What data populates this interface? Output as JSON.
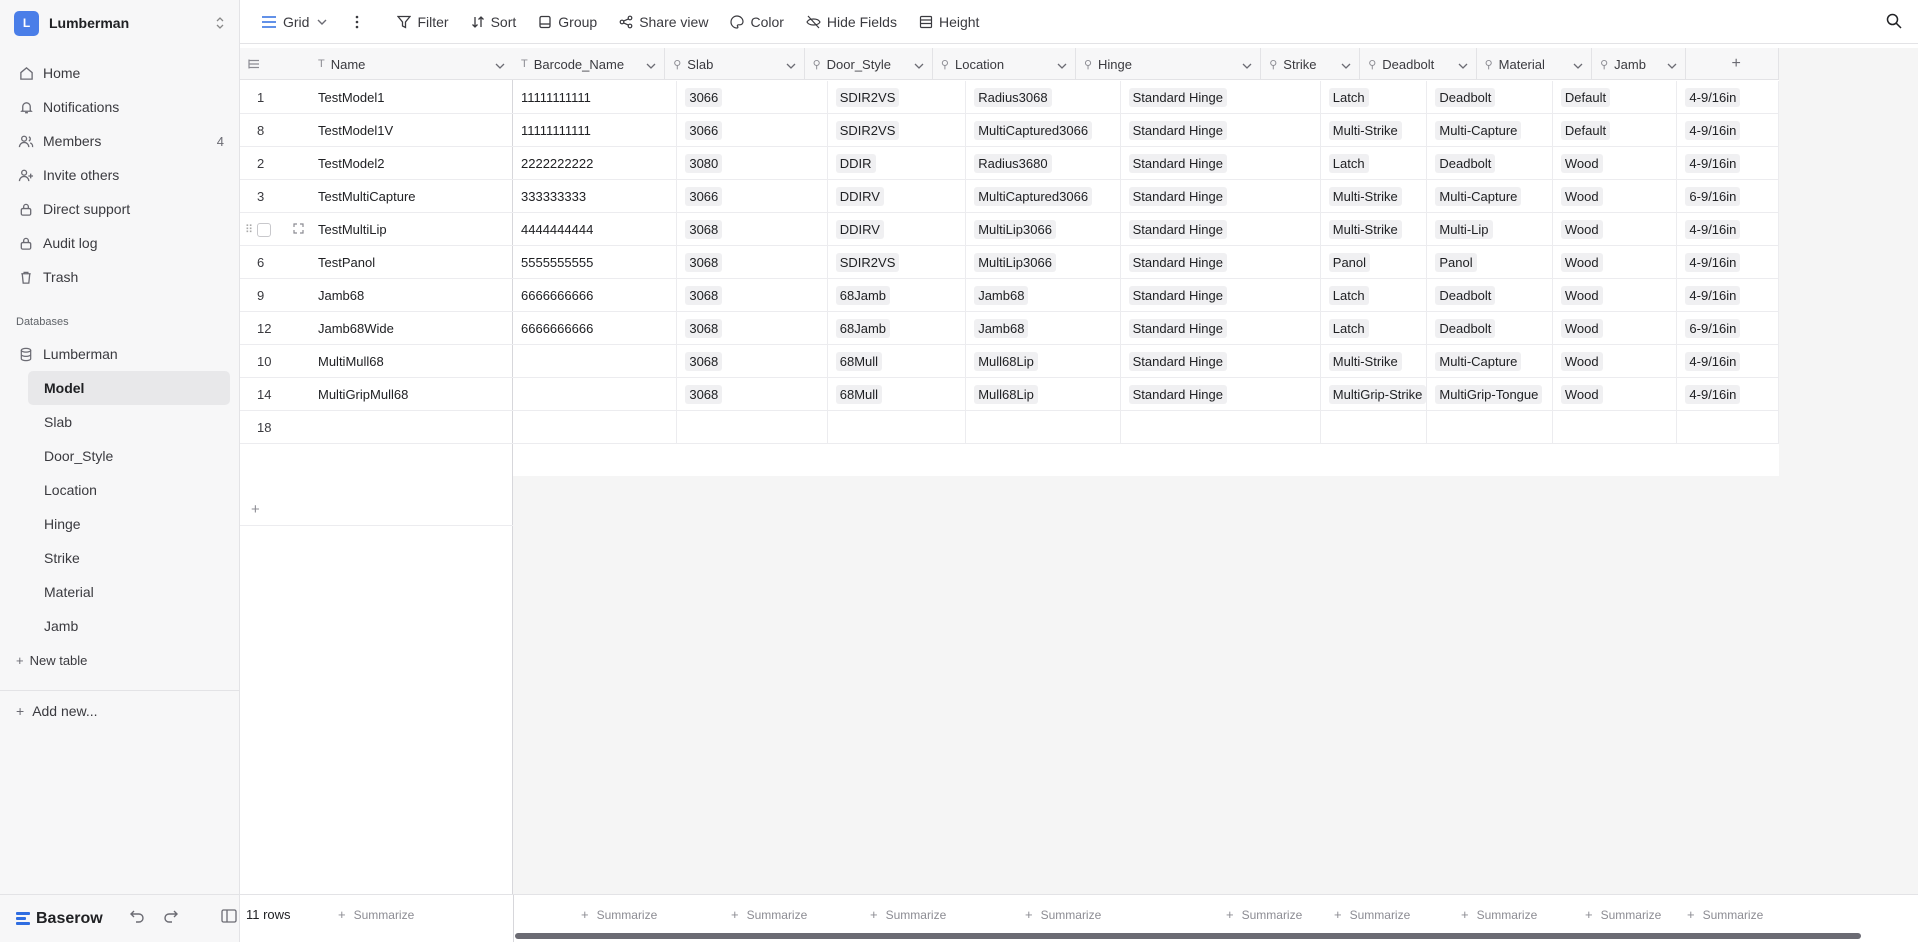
{
  "workspace": {
    "initial": "L",
    "name": "Lumberman"
  },
  "nav": [
    {
      "label": "Home",
      "icon": "home-icon"
    },
    {
      "label": "Notifications",
      "icon": "bell-icon"
    },
    {
      "label": "Members",
      "icon": "users-icon",
      "count": "4"
    },
    {
      "label": "Invite others",
      "icon": "user-plus-icon"
    },
    {
      "label": "Direct support",
      "icon": "lock-icon"
    },
    {
      "label": "Audit log",
      "icon": "lock-icon"
    },
    {
      "label": "Trash",
      "icon": "trash-icon"
    }
  ],
  "databases_title": "Databases",
  "database": {
    "label": "Lumberman"
  },
  "tables": [
    "Model",
    "Slab",
    "Door_Style",
    "Location",
    "Hinge",
    "Strike",
    "Material",
    "Jamb"
  ],
  "active_table": "Model",
  "new_table_label": "New table",
  "add_new_label": "Add new...",
  "brand": "Baserow",
  "header": {
    "view_label": "Grid",
    "filter": "Filter",
    "sort": "Sort",
    "group": "Group",
    "share": "Share view",
    "color": "Color",
    "hide_fields": "Hide Fields",
    "height": "Height"
  },
  "grid": {
    "primary_column": "Name",
    "columns": [
      "Barcode_Name",
      "Slab",
      "Door_Style",
      "Location",
      "Hinge",
      "Strike",
      "Deadbolt",
      "Material",
      "Jamb"
    ],
    "rows": [
      {
        "id": "1",
        "name": "TestModel1",
        "cells": [
          "11111111111",
          "3066",
          "SDIR2VS",
          "Radius3068",
          "Standard Hinge",
          "Latch",
          "Deadbolt",
          "Default",
          "4-9/16in"
        ]
      },
      {
        "id": "8",
        "name": "TestModel1V",
        "cells": [
          "11111111111",
          "3066",
          "SDIR2VS",
          "MultiCaptured3066",
          "Standard Hinge",
          "Multi-Strike",
          "Multi-Capture",
          "Default",
          "4-9/16in"
        ]
      },
      {
        "id": "2",
        "name": "TestModel2",
        "cells": [
          "2222222222",
          "3080",
          "DDIR",
          "Radius3680",
          "Standard Hinge",
          "Latch",
          "Deadbolt",
          "Wood",
          "4-9/16in"
        ]
      },
      {
        "id": "3",
        "name": "TestMultiCapture",
        "cells": [
          "333333333",
          "3066",
          "DDIRV",
          "MultiCaptured3066",
          "Standard Hinge",
          "Multi-Strike",
          "Multi-Capture",
          "Wood",
          "6-9/16in"
        ]
      },
      {
        "id": "",
        "name": "TestMultiLip",
        "cells": [
          "4444444444",
          "3068",
          "DDIRV",
          "MultiLip3066",
          "Standard Hinge",
          "Multi-Strike",
          "Multi-Lip",
          "Wood",
          "4-9/16in"
        ]
      },
      {
        "id": "6",
        "name": "TestPanol",
        "cells": [
          "5555555555",
          "3068",
          "SDIR2VS",
          "MultiLip3066",
          "Standard Hinge",
          "Panol",
          "Panol",
          "Wood",
          "4-9/16in"
        ]
      },
      {
        "id": "9",
        "name": "Jamb68",
        "cells": [
          "6666666666",
          "3068",
          "68Jamb",
          "Jamb68",
          "Standard Hinge",
          "Latch",
          "Deadbolt",
          "Wood",
          "4-9/16in"
        ]
      },
      {
        "id": "12",
        "name": "Jamb68Wide",
        "cells": [
          "6666666666",
          "3068",
          "68Jamb",
          "Jamb68",
          "Standard Hinge",
          "Latch",
          "Deadbolt",
          "Wood",
          "6-9/16in"
        ]
      },
      {
        "id": "10",
        "name": "MultiMull68",
        "cells": [
          "",
          "3068",
          "68Mull",
          "Mull68Lip",
          "Standard Hinge",
          "Multi-Strike",
          "Multi-Capture",
          "Wood",
          "4-9/16in"
        ]
      },
      {
        "id": "14",
        "name": "MultiGripMull68",
        "cells": [
          "",
          "3068",
          "68Mull",
          "Mull68Lip",
          "Standard Hinge",
          "MultiGrip-Strike",
          "MultiGrip-Tongue",
          "Wood",
          "4-9/16in"
        ]
      },
      {
        "id": "18",
        "name": "",
        "cells": [
          "",
          "",
          "",
          "",
          "",
          "",
          "",
          "",
          ""
        ]
      }
    ]
  },
  "footer": {
    "rows_count": "11 rows",
    "summarize": "Summarize"
  }
}
